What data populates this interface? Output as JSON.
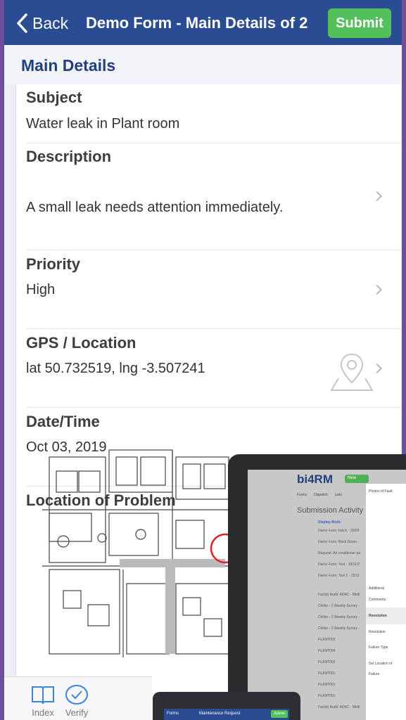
{
  "nav": {
    "back_label": "Back",
    "title": "Demo Form - Main Details of 2",
    "submit_label": "Submit"
  },
  "section": {
    "title": "Main Details"
  },
  "fields": {
    "subject": {
      "label": "Subject",
      "value": "Water leak in Plant room"
    },
    "description": {
      "label": "Description",
      "value": "A small leak needs attention immediately."
    },
    "priority": {
      "label": "Priority",
      "value": "High"
    },
    "gps": {
      "label": "GPS / Location",
      "value": "lat 50.732519, lng -3.507241"
    },
    "datetime": {
      "label": "Date/Time",
      "value": "Oct 03, 2019"
    },
    "location_problem": {
      "label": "Location of Problem"
    }
  },
  "tablet": {
    "logo": "bi4RM",
    "new_label": "New",
    "toolbar": [
      "Forms",
      "Dispatch",
      "Lists"
    ],
    "subtitle": "Submission Activity",
    "display_mode": "Display Mode",
    "rows": [
      "Demo Form: batch - 20/09",
      "Demo Form: Brick Demo -",
      "Request: Air conditioner pa",
      "Demo Form: Test - 15/11/2",
      "Demo Form: Test 2 - 15/11",
      "Facility Audit: ADAC - Midfi",
      "Chiller - 2 Weekly Survey -",
      "Chiller - 2 Weekly Survey -",
      "Chiller - 2 Weekly Survey -",
      "PLANT003",
      "PLANT004",
      "PLANT002",
      "PLANT001",
      "PLANT001",
      "PLANT001",
      "Facility Audit: ADAC - Midfi"
    ],
    "panel": {
      "photos": "Photos of Fault",
      "additional": "Additional",
      "comments": "Comments",
      "resolution_head": "Resolution",
      "resolution": "Resolution",
      "failure_type": "Failure Type",
      "set_location": "Set Location of",
      "failure": "Failure"
    }
  },
  "phone2": {
    "back_label": "Forms",
    "title": "Maintenance Request",
    "submit_label": "Submit"
  },
  "tabs": {
    "index": "Index",
    "verify": "Verify"
  },
  "colors": {
    "nav_bg": "#2a4c92",
    "submit_green": "#52c15c",
    "section_title": "#223f7f"
  }
}
